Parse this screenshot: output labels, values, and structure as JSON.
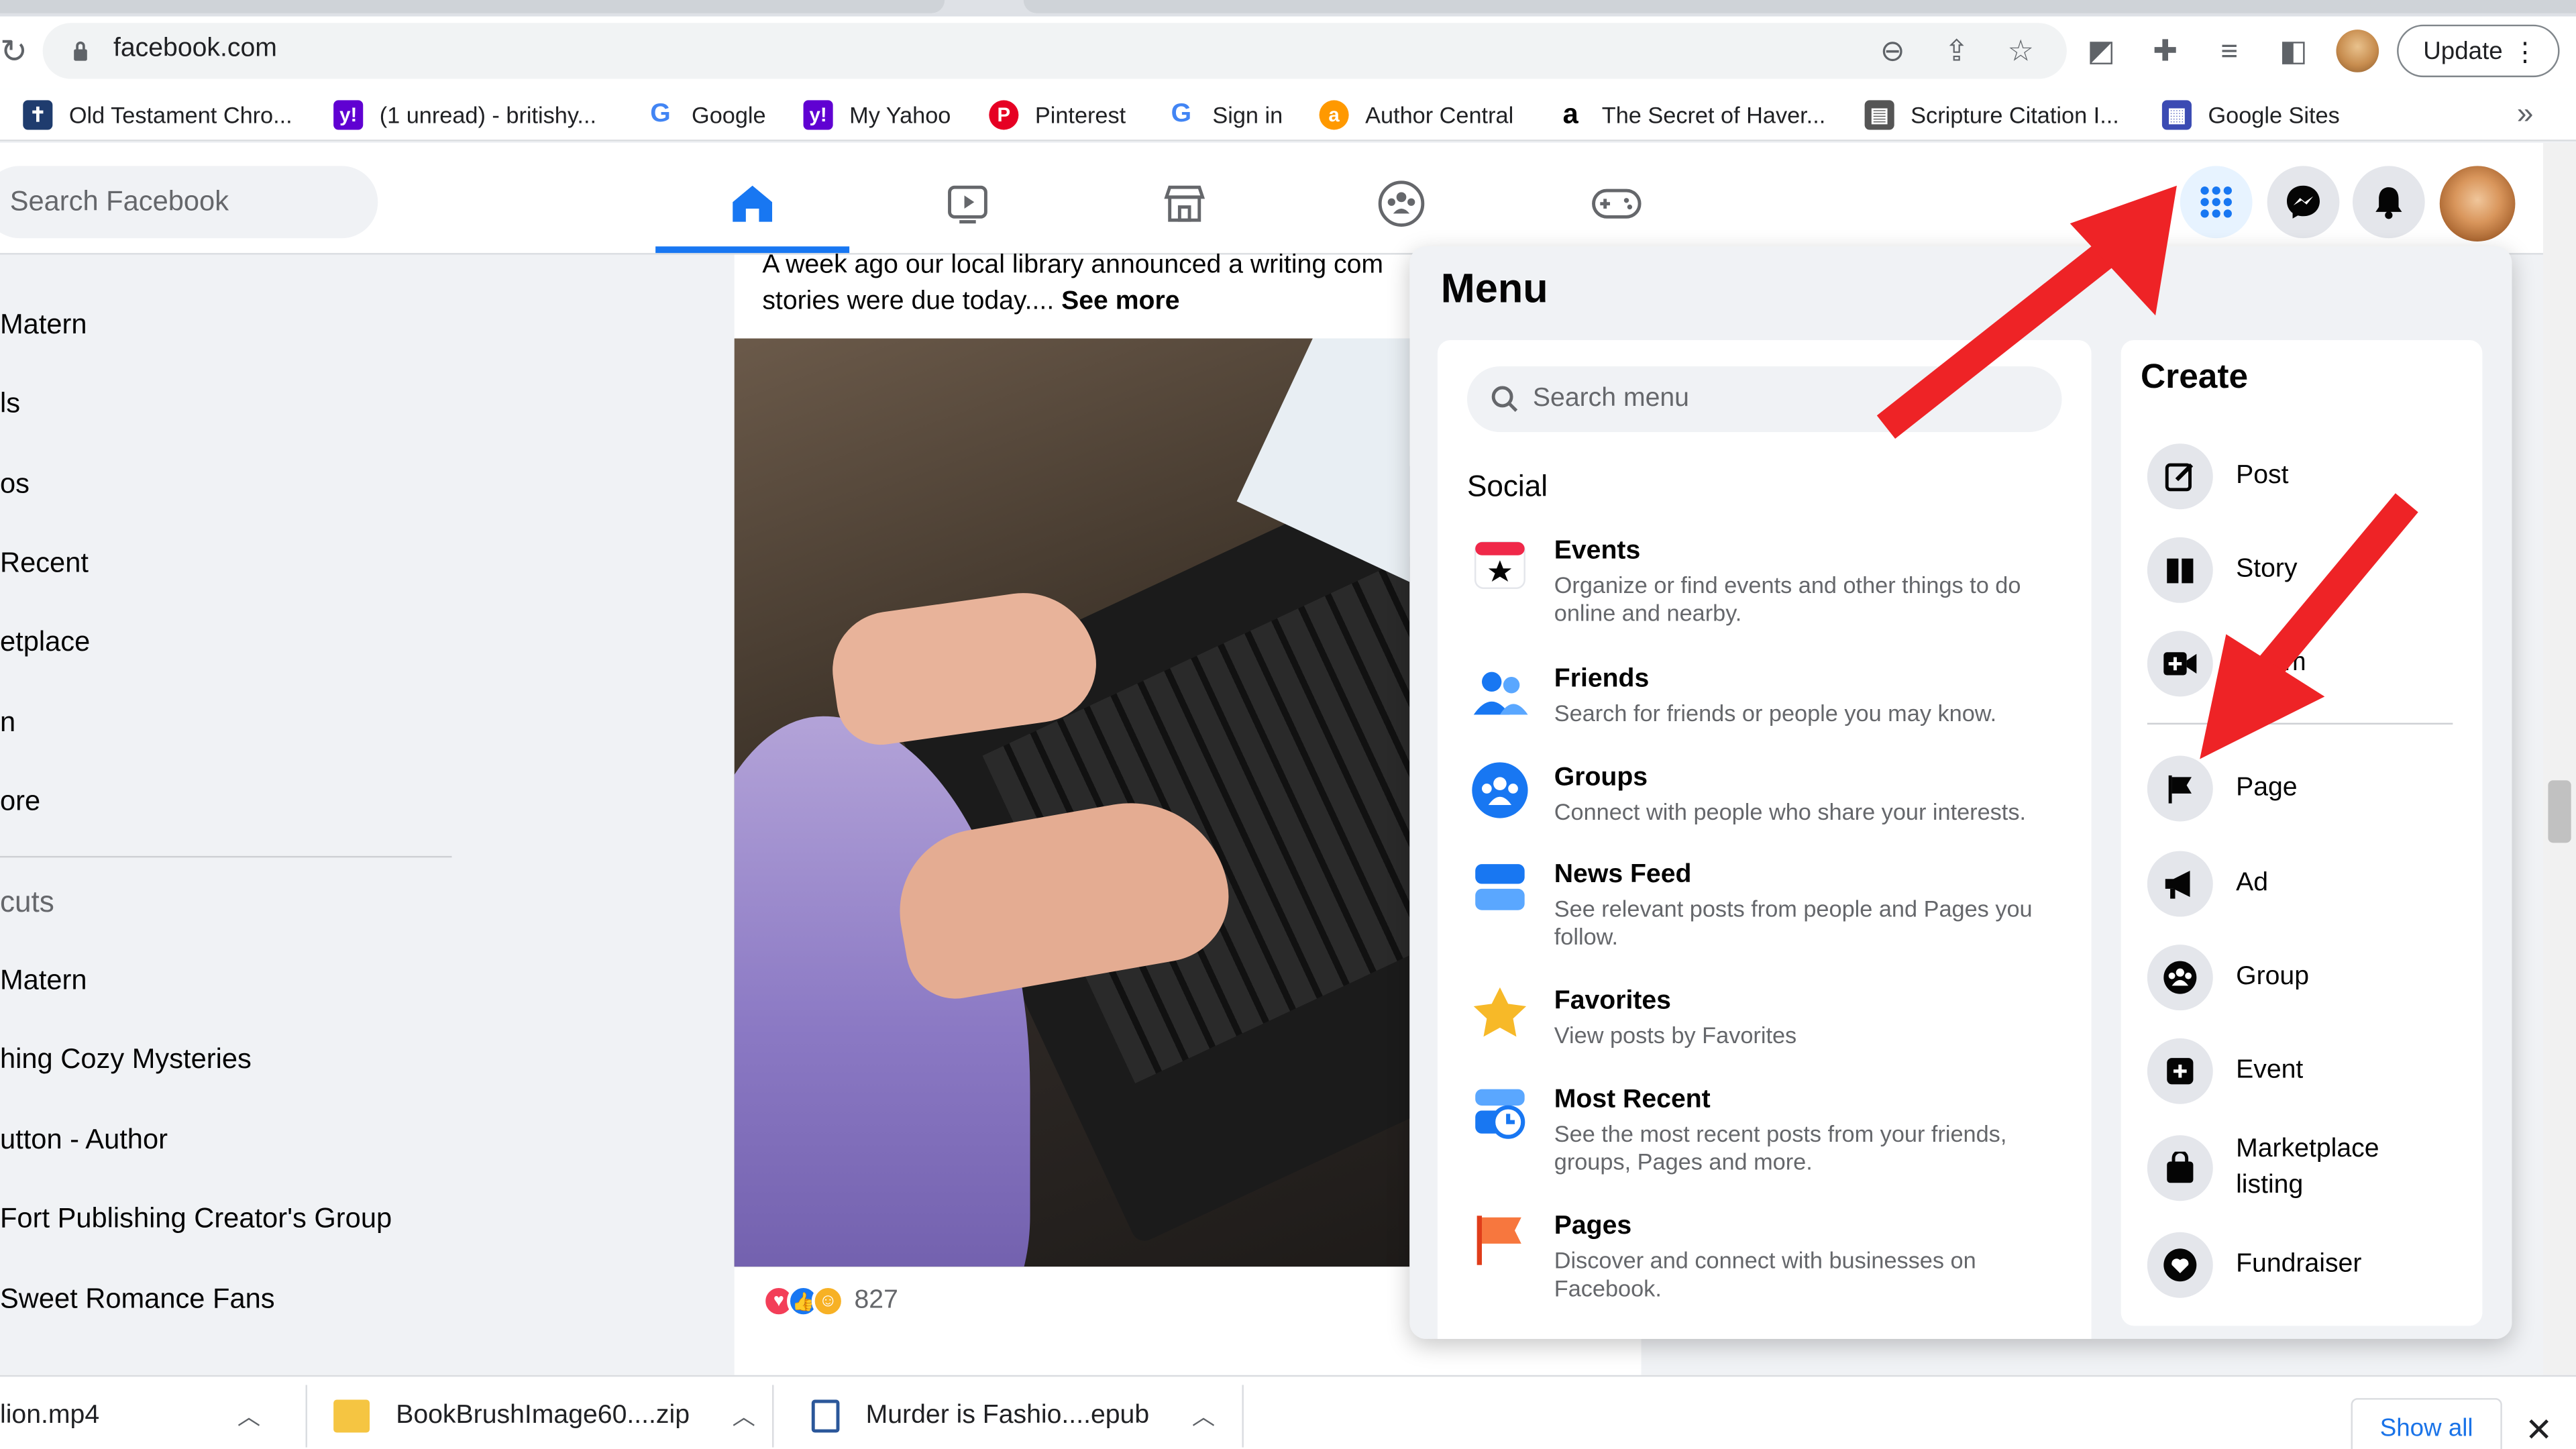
{
  "browser": {
    "url": "facebook.com",
    "update_label": "Update",
    "bookmarks": [
      {
        "label": "Old Testament Chro...",
        "icon": "bible-icon",
        "color": "#1f3c6e"
      },
      {
        "label": "(1 unread) - britishy...",
        "icon": "yahoo-mail-icon",
        "color": "#6001d2"
      },
      {
        "label": "Google",
        "icon": "google-icon",
        "color": "#4285f4"
      },
      {
        "label": "My Yahoo",
        "icon": "yahoo-icon",
        "color": "#6001d2"
      },
      {
        "label": "Pinterest",
        "icon": "pinterest-icon",
        "color": "#e60023"
      },
      {
        "label": "Sign in",
        "icon": "google-icon",
        "color": "#4285f4"
      },
      {
        "label": "Author Central",
        "icon": "author-central-icon",
        "color": "#ff9900"
      },
      {
        "label": "The Secret of Haver...",
        "icon": "amazon-icon",
        "color": "#232f3e"
      },
      {
        "label": "Scripture Citation I...",
        "icon": "scripture-icon",
        "color": "#555555"
      },
      {
        "label": "Google Sites",
        "icon": "google-sites-icon",
        "color": "#3b4bb3"
      }
    ]
  },
  "facebook": {
    "search_placeholder": "Search Facebook",
    "sidebar": {
      "items": [
        "Matern",
        "ls",
        "os",
        "Recent",
        "etplace",
        "n",
        "ore"
      ],
      "shortcuts_heading": "cuts",
      "shortcuts": [
        "Matern",
        "hing Cozy Mysteries",
        "utton - Author",
        "Fort Publishing Creator's Group",
        "Sweet Romance Fans"
      ]
    },
    "post": {
      "text": "A week ago our local library announced a writing com",
      "text_line2": "stories were due today.... ",
      "see_more": "See more",
      "reaction_count": "827"
    },
    "menu": {
      "title": "Menu",
      "search_placeholder": "Search menu",
      "social_heading": "Social",
      "items": [
        {
          "title": "Events",
          "desc": "Organize or find events and other things to do online and nearby.",
          "icon": "events-icon"
        },
        {
          "title": "Friends",
          "desc": "Search for friends or people you may know.",
          "icon": "friends-icon"
        },
        {
          "title": "Groups",
          "desc": "Connect with people who share your interests.",
          "icon": "groups-icon"
        },
        {
          "title": "News Feed",
          "desc": "See relevant posts from people and Pages you follow.",
          "icon": "news-feed-icon"
        },
        {
          "title": "Favorites",
          "desc": "View posts by Favorites",
          "icon": "favorites-star-icon"
        },
        {
          "title": "Most Recent",
          "desc": "See the most recent posts from your friends, groups, Pages and more.",
          "icon": "most-recent-icon"
        },
        {
          "title": "Pages",
          "desc": "Discover and connect with businesses on Facebook.",
          "icon": "pages-flag-icon"
        }
      ],
      "create_heading": "Create",
      "create_items": [
        {
          "label": "Post",
          "icon": "edit-icon"
        },
        {
          "label": "Story",
          "icon": "book-icon"
        },
        {
          "label": "Room",
          "icon": "video-plus-icon"
        },
        {
          "label": "Page",
          "icon": "flag-icon"
        },
        {
          "label": "Ad",
          "icon": "megaphone-icon"
        },
        {
          "label": "Group",
          "icon": "group-icon"
        },
        {
          "label": "Event",
          "icon": "event-plus-icon"
        },
        {
          "label": "Marketplace listing",
          "icon": "shopping-bag-icon"
        },
        {
          "label": "Fundraiser",
          "icon": "fundraiser-icon"
        }
      ]
    }
  },
  "downloads": {
    "items": [
      "lion.mp4",
      "BookBrushImage60....zip",
      "Murder is Fashio....epub"
    ],
    "show_all": "Show all"
  },
  "colors": {
    "fb_blue": "#1877f2",
    "arrow_red": "#ee2326"
  }
}
